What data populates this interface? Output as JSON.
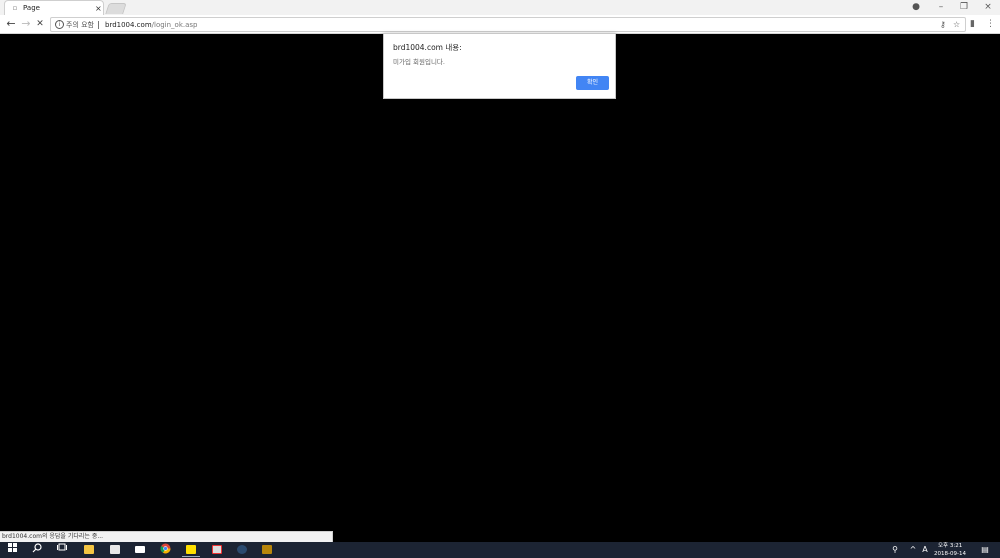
{
  "browser": {
    "tab": {
      "title": "Page",
      "favicon": "page-icon",
      "close": "×"
    },
    "window_controls": {
      "account": "●",
      "minimize": "–",
      "restore": "❐",
      "close": "×"
    },
    "nav": {
      "back": "←",
      "forward": "→",
      "stop": "✕"
    },
    "omnibox": {
      "info_glyph": "i",
      "security_label": "주의 요함",
      "url_domain": "brd1004.com",
      "url_path": "/login_ok.asp",
      "key_icon": "⚷",
      "star_icon": "☆"
    },
    "toolbar_icons": {
      "extension": "▮",
      "menu": "⋮"
    }
  },
  "dialog": {
    "title": "brd1004.com 내용:",
    "message": "미가입 회원입니다.",
    "ok_label": "확인",
    "ok_color": "#4285f4"
  },
  "status": {
    "text": "brd1004.com의 응답을 기다리는 중..."
  },
  "taskbar": {
    "background": "#1c2433",
    "tray": {
      "language": "A",
      "time": "오후 3:21",
      "date": "2018-09-14"
    }
  }
}
